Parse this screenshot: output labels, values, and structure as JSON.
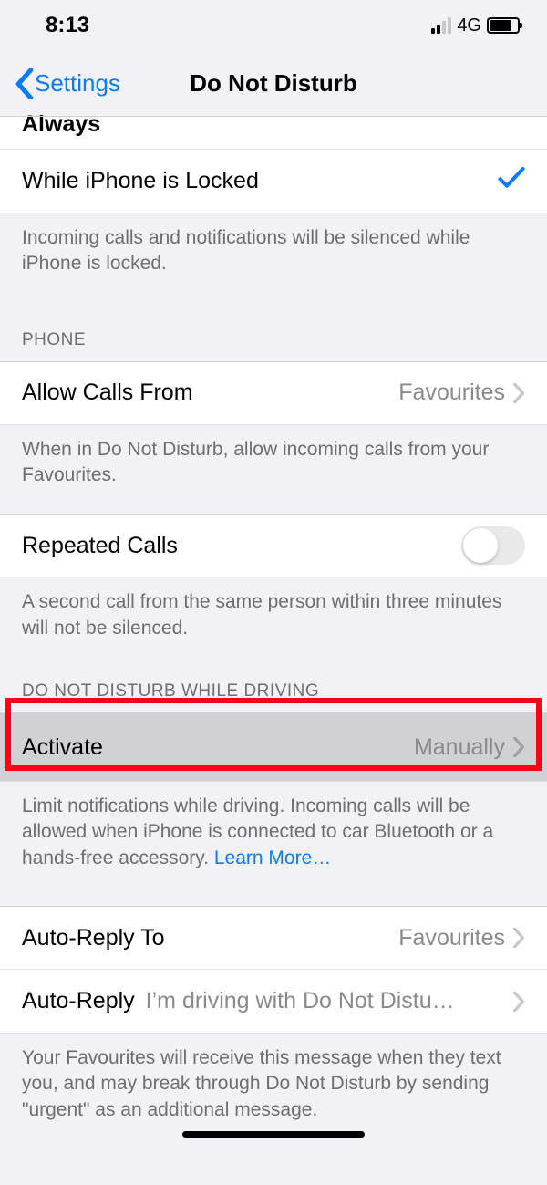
{
  "status": {
    "time": "8:13",
    "network": "4G"
  },
  "nav": {
    "back": "Settings",
    "title": "Do Not Disturb"
  },
  "silence": {
    "option1": "Always",
    "option2": "While iPhone is Locked",
    "footer": "Incoming calls and notifications will be silenced while iPhone is locked."
  },
  "phone": {
    "header": "Phone",
    "allow_label": "Allow Calls From",
    "allow_value": "Favourites",
    "allow_footer": "When in Do Not Disturb, allow incoming calls from your Favourites.",
    "repeated_label": "Repeated Calls",
    "repeated_footer": "A second call from the same person within three minutes will not be silenced."
  },
  "driving": {
    "header": "Do Not Disturb While Driving",
    "activate_label": "Activate",
    "activate_value": "Manually",
    "activate_footer": "Limit notifications while driving. Incoming calls will be allowed when iPhone is connected to car Bluetooth or a hands-free accessory. ",
    "learn_more": "Learn More…",
    "autoreplyto_label": "Auto-Reply To",
    "autoreplyto_value": "Favourites",
    "autoreply_label": "Auto-Reply",
    "autoreply_value": "I’m driving with Do Not Distu…",
    "autoreply_footer": "Your Favourites will receive this message when they text you, and may break through Do Not Disturb by sending \"urgent\" as an additional message."
  }
}
